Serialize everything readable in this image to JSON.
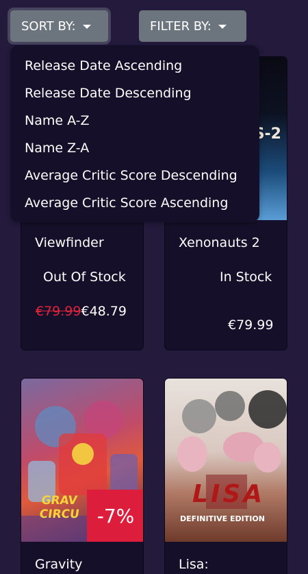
{
  "toolbar": {
    "sort_label": "SORT BY:",
    "filter_label": "FILTER BY:"
  },
  "sort_menu": {
    "options": [
      "Release Date Ascending",
      "Release Date Descending",
      "Name A-Z",
      "Name Z-A",
      "Average Critic Score Descending",
      "Average Critic Score Ascending"
    ]
  },
  "products": [
    {
      "title": "Viewfinder",
      "stock": "Out Of Stock",
      "old_price": "€79.99",
      "price": "€48.79"
    },
    {
      "title": "Xenonauts 2",
      "stock": "In Stock",
      "price": "€79.99",
      "image_text": "S-2"
    },
    {
      "title": "Gravity",
      "discount": "-7%",
      "image_text": "GRAV CIRCU"
    },
    {
      "title": "Lisa:",
      "image_text": "LISA",
      "image_subtext": "DEFINITIVE EDITION"
    }
  ],
  "colors": {
    "background": "#231a3c",
    "card": "#160f29",
    "button": "#6c757d",
    "discount": "#dc1e3c",
    "strike": "#e0243c"
  }
}
